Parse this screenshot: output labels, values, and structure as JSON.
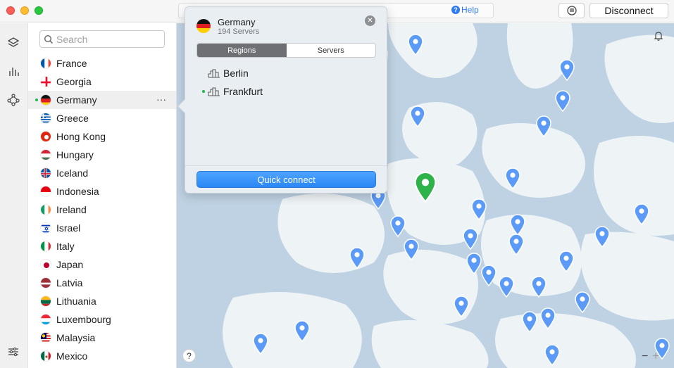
{
  "titlebar": {
    "help_label": "Help",
    "disconnect_label": "Disconnect"
  },
  "search": {
    "placeholder": "Search"
  },
  "countries": [
    {
      "name": "France",
      "flag": "france"
    },
    {
      "name": "Georgia",
      "flag": "georgia"
    },
    {
      "name": "Germany",
      "flag": "germany",
      "active": true
    },
    {
      "name": "Greece",
      "flag": "greece"
    },
    {
      "name": "Hong Kong",
      "flag": "hongkong"
    },
    {
      "name": "Hungary",
      "flag": "hungary"
    },
    {
      "name": "Iceland",
      "flag": "iceland"
    },
    {
      "name": "Indonesia",
      "flag": "indonesia"
    },
    {
      "name": "Ireland",
      "flag": "ireland"
    },
    {
      "name": "Israel",
      "flag": "israel"
    },
    {
      "name": "Italy",
      "flag": "italy"
    },
    {
      "name": "Japan",
      "flag": "japan"
    },
    {
      "name": "Latvia",
      "flag": "latvia"
    },
    {
      "name": "Lithuania",
      "flag": "lithuania"
    },
    {
      "name": "Luxembourg",
      "flag": "luxembourg"
    },
    {
      "name": "Malaysia",
      "flag": "malaysia"
    },
    {
      "name": "Mexico",
      "flag": "mexico"
    }
  ],
  "more_label": "···",
  "popover": {
    "country": "Germany",
    "servers": "194 Servers",
    "tabs": [
      "Regions",
      "Servers"
    ],
    "active_tab": "Regions",
    "regions": [
      {
        "name": "Berlin",
        "active": false
      },
      {
        "name": "Frankfurt",
        "active": true
      }
    ],
    "quick_connect_label": "Quick connect"
  },
  "map": {
    "help_label": "?",
    "zoom_out_label": "−",
    "zoom_in_label": "+"
  },
  "colors": {
    "marker": "#5b9bf7",
    "active_marker": "#2db34a",
    "water": "#bed2e3",
    "land": "#eef3f6",
    "accent": "#2a87f5"
  }
}
